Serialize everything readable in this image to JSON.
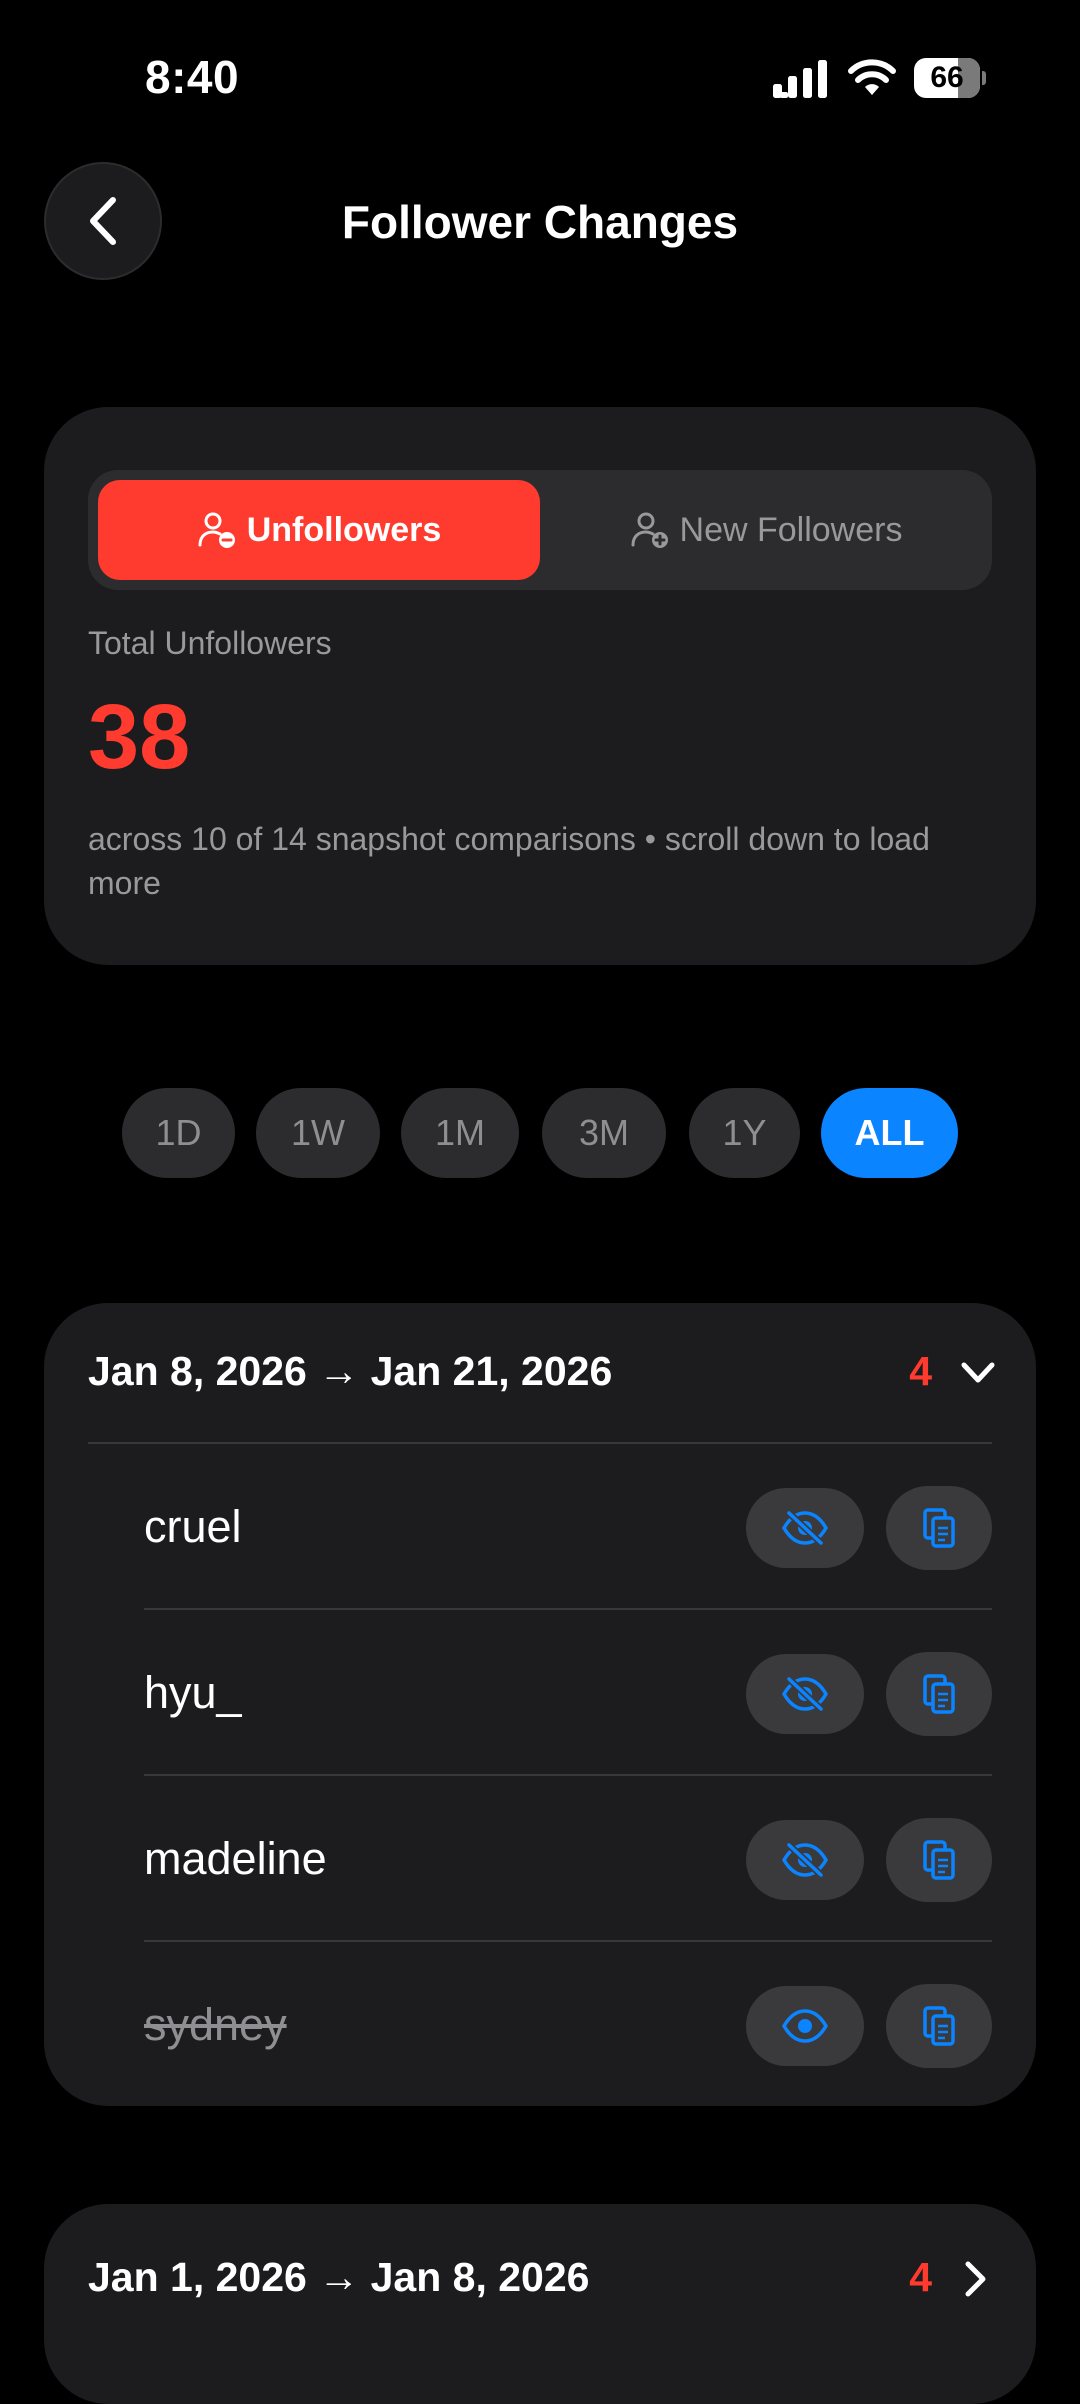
{
  "status_bar": {
    "time": "8:40",
    "battery": "66"
  },
  "header": {
    "title": "Follower Changes"
  },
  "summary": {
    "tabs": [
      {
        "label": "Unfollowers",
        "active": true
      },
      {
        "label": "New Followers",
        "active": false
      }
    ],
    "total_label": "Total Unfollowers",
    "total_value": "38",
    "subtitle": "across 10 of 14 snapshot comparisons • scroll down to load more"
  },
  "ranges": [
    "1D",
    "1W",
    "1M",
    "3M",
    "1Y",
    "ALL"
  ],
  "selected_range": "ALL",
  "groups": [
    {
      "title": "Jan 8, 2026 → Jan 21, 2026",
      "count": "4",
      "expanded": true,
      "users": [
        {
          "name": "cruel",
          "hidden": false
        },
        {
          "name": "hyu_",
          "hidden": false
        },
        {
          "name": "madeline",
          "hidden": false
        },
        {
          "name": "sydney",
          "hidden": true
        }
      ]
    },
    {
      "title": "Jan 1, 2026 → Jan 8, 2026",
      "count": "4",
      "expanded": false
    }
  ],
  "colors": {
    "accent_red": "#ff3b30",
    "accent_blue": "#0a84ff",
    "card": "#1c1c1e"
  }
}
